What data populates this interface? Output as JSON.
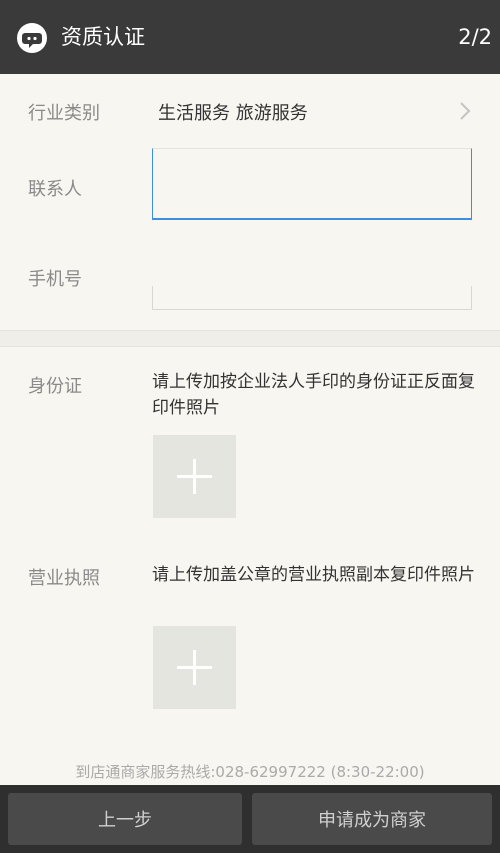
{
  "header": {
    "title": "资质认证",
    "step": "2/2"
  },
  "form": {
    "industry": {
      "label": "行业类别",
      "value": "生活服务 旅游服务"
    },
    "contact": {
      "label": "联系人",
      "value": ""
    },
    "phone": {
      "label": "手机号",
      "value": ""
    }
  },
  "uploads": [
    {
      "label": "身份证",
      "desc": "请上传加按企业法人手印的身份证正反面复印件照片"
    },
    {
      "label": "营业执照",
      "desc": "请上传加盖公章的营业执照副本复印件照片"
    }
  ],
  "hotline": "到店通商家服务热线:028-62997222 (8:30-22:00)",
  "footer": {
    "prev_label": "上一步",
    "apply_label": "申请成为商家"
  },
  "colors": {
    "header_bg": "#3a3a3a",
    "focus_border": "#3a8fe0",
    "footer_bg": "#2f2f2f"
  }
}
